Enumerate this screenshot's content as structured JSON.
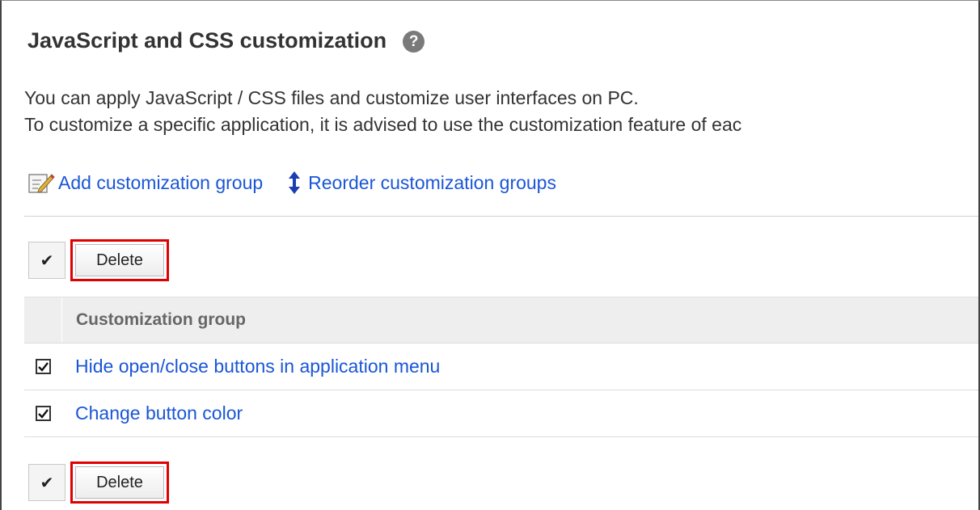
{
  "header": {
    "title": "JavaScript and CSS customization",
    "help_icon": "question-circle-icon"
  },
  "description": {
    "line1": "You can apply JavaScript / CSS files and customize user interfaces on PC.",
    "line2": "To customize a specific application, it is advised to use the customization feature of eac"
  },
  "actions": {
    "add_label": "Add customization group",
    "add_icon": "edit-note-icon",
    "reorder_label": "Reorder customization groups",
    "reorder_icon": "up-down-arrow-icon"
  },
  "toolbar_top": {
    "check_all_symbol": "✔",
    "delete_label": "Delete"
  },
  "table": {
    "column_header": "Customization group",
    "rows": [
      {
        "label": "Hide open/close buttons in application menu",
        "checked": true
      },
      {
        "label": "Change button color",
        "checked": true
      }
    ]
  },
  "toolbar_bottom": {
    "check_all_symbol": "✔",
    "delete_label": "Delete"
  },
  "colors": {
    "link": "#1a56d6",
    "highlight": "#e10000",
    "header_bg": "#eeeeee"
  }
}
